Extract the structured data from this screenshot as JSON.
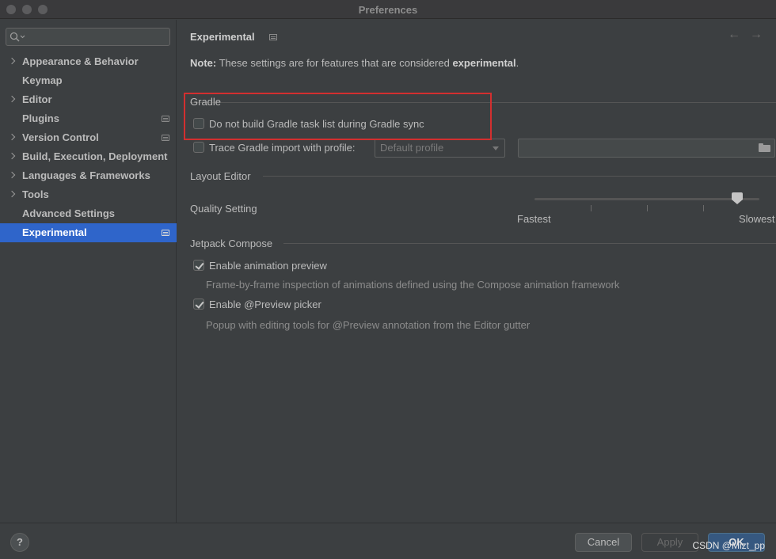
{
  "window": {
    "title": "Preferences"
  },
  "sidebar": {
    "search_placeholder": "",
    "items": [
      {
        "label": "Appearance & Behavior",
        "expandable": true,
        "project_level": false,
        "selected": false
      },
      {
        "label": "Keymap",
        "expandable": false,
        "project_level": false,
        "selected": false
      },
      {
        "label": "Editor",
        "expandable": true,
        "project_level": false,
        "selected": false
      },
      {
        "label": "Plugins",
        "expandable": false,
        "project_level": true,
        "selected": false
      },
      {
        "label": "Version Control",
        "expandable": true,
        "project_level": true,
        "selected": false
      },
      {
        "label": "Build, Execution, Deployment",
        "expandable": true,
        "project_level": false,
        "selected": false
      },
      {
        "label": "Languages & Frameworks",
        "expandable": true,
        "project_level": false,
        "selected": false
      },
      {
        "label": "Tools",
        "expandable": true,
        "project_level": false,
        "selected": false
      },
      {
        "label": "Advanced Settings",
        "expandable": false,
        "project_level": false,
        "selected": false
      },
      {
        "label": "Experimental",
        "expandable": false,
        "project_level": true,
        "selected": true
      }
    ]
  },
  "page": {
    "title": "Experimental",
    "note_label": "Note:",
    "note_text": " These settings are for features that are considered ",
    "note_emphasis": "experimental",
    "note_end": "."
  },
  "gradle": {
    "heading": "Gradle",
    "no_task_list": {
      "label": "Do not build Gradle task list during Gradle sync",
      "checked": false
    },
    "trace_import": {
      "label": "Trace Gradle import with profile:",
      "checked": false
    },
    "profile_select": "Default profile",
    "profile_path": ""
  },
  "layout_editor": {
    "heading": "Layout Editor",
    "quality_label": "Quality Setting",
    "slider_min_label": "Fastest",
    "slider_max_label": "Slowest",
    "slider_value": 0.9
  },
  "jetpack_compose": {
    "heading": "Jetpack Compose",
    "animation_preview": {
      "label": "Enable animation preview",
      "checked": true,
      "description": "Frame-by-frame inspection of animations defined using the Compose animation framework"
    },
    "preview_picker": {
      "label": "Enable @Preview picker",
      "checked": true,
      "description": "Popup with editing tools for @Preview annotation from the Editor gutter"
    }
  },
  "footer": {
    "help": "?",
    "cancel": "Cancel",
    "apply": "Apply",
    "ok": "OK",
    "watermark": "CSDN @Mizt_pp"
  },
  "colors": {
    "selection": "#2f65ca",
    "highlight_box": "#d32f2f",
    "ok_button": "#365880"
  }
}
